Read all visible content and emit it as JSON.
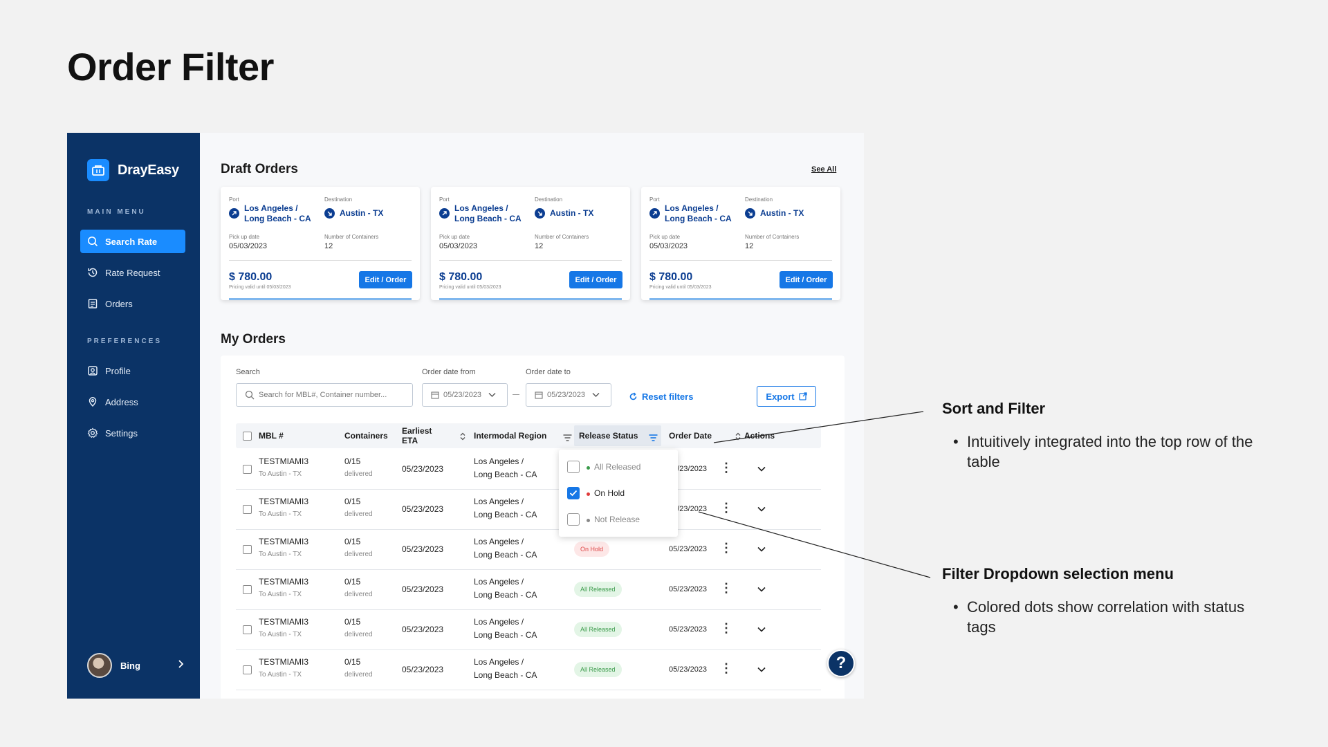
{
  "slide": {
    "title": "Order Filter"
  },
  "brand": {
    "name": "DrayEasy",
    "accent": "#1a8cff",
    "navy": "#0b3366"
  },
  "sidebar": {
    "main_menu_heading": "MAIN MENU",
    "preferences_heading": "PREFERENCES",
    "items": [
      {
        "label": "Search Rate",
        "icon": "search-icon",
        "active": true
      },
      {
        "label": "Rate Request",
        "icon": "history-icon"
      },
      {
        "label": "Orders",
        "icon": "document-icon"
      },
      {
        "label": "Profile",
        "icon": "profile-icon"
      },
      {
        "label": "Address",
        "icon": "location-pin-icon"
      },
      {
        "label": "Settings",
        "icon": "gear-icon"
      }
    ],
    "user": {
      "name": "Bing"
    }
  },
  "draft_orders": {
    "title": "Draft Orders",
    "see_all": "See All",
    "cards": [
      {
        "port_label": "Port",
        "port_line1": "Los Angeles /",
        "port_line2": "Long Beach - CA",
        "dest_label": "Destination",
        "dest": "Austin - TX",
        "pickup_label": "Pick up date",
        "pickup": "05/03/2023",
        "containers_label": "Number of Containers",
        "containers": "12",
        "price": "$ 780.00",
        "price_note": "Pricing valid until 05/03/2023",
        "button": "Edit / Order"
      },
      {
        "port_label": "Port",
        "port_line1": "Los Angeles /",
        "port_line2": "Long Beach - CA",
        "dest_label": "Destination",
        "dest": "Austin - TX",
        "pickup_label": "Pick up date",
        "pickup": "05/03/2023",
        "containers_label": "Number of Containers",
        "containers": "12",
        "price": "$ 780.00",
        "price_note": "Pricing valid until 05/03/2023",
        "button": "Edit / Order"
      },
      {
        "port_label": "Port",
        "port_line1": "Los Angeles /",
        "port_line2": "Long Beach - CA",
        "dest_label": "Destination",
        "dest": "Austin - TX",
        "pickup_label": "Pick up date",
        "pickup": "05/03/2023",
        "containers_label": "Number of Containers",
        "containers": "12",
        "price": "$ 780.00",
        "price_note": "Pricing valid until 05/03/2023",
        "button": "Edit / Order"
      }
    ]
  },
  "my_orders": {
    "title": "My Orders",
    "search_label": "Search",
    "search_placeholder": "Search for MBL#, Container number...",
    "date_from_label": "Order date from",
    "date_from": "05/23/2023",
    "date_to_label": "Order date to",
    "date_to": "05/23/2023",
    "reset_label": "Reset filters",
    "export_label": "Export",
    "columns": {
      "mbl": "MBL #",
      "containers": "Containers",
      "eta": "Earliest ETA",
      "region": "Intermodal Region",
      "release": "Release Status",
      "order_date": "Order Date",
      "actions": "Actions"
    },
    "rows": [
      {
        "mbl": "TESTMIAMI3",
        "to": "To Austin - TX",
        "containers": "0/15",
        "delivered": "delivered",
        "eta": "05/23/2023",
        "region1": "Los Angeles /",
        "region2": "Long Beach - CA",
        "status": "",
        "order_date": "05/23/2023"
      },
      {
        "mbl": "TESTMIAMI3",
        "to": "To Austin - TX",
        "containers": "0/15",
        "delivered": "delivered",
        "eta": "05/23/2023",
        "region1": "Los Angeles /",
        "region2": "Long Beach - CA",
        "status": "",
        "order_date": "05/23/2023"
      },
      {
        "mbl": "TESTMIAMI3",
        "to": "To Austin - TX",
        "containers": "0/15",
        "delivered": "delivered",
        "eta": "05/23/2023",
        "region1": "Los Angeles /",
        "region2": "Long Beach - CA",
        "status": "On Hold",
        "order_date": "05/23/2023"
      },
      {
        "mbl": "TESTMIAMI3",
        "to": "To Austin - TX",
        "containers": "0/15",
        "delivered": "delivered",
        "eta": "05/23/2023",
        "region1": "Los Angeles /",
        "region2": "Long Beach - CA",
        "status": "All Released",
        "order_date": "05/23/2023"
      },
      {
        "mbl": "TESTMIAMI3",
        "to": "To Austin - TX",
        "containers": "0/15",
        "delivered": "delivered",
        "eta": "05/23/2023",
        "region1": "Los Angeles /",
        "region2": "Long Beach - CA",
        "status": "All Released",
        "order_date": "05/23/2023"
      },
      {
        "mbl": "TESTMIAMI3",
        "to": "To Austin - TX",
        "containers": "0/15",
        "delivered": "delivered",
        "eta": "05/23/2023",
        "region1": "Los Angeles /",
        "region2": "Long Beach - CA",
        "status": "All Released",
        "order_date": "05/23/2023"
      }
    ],
    "filter_dropdown": {
      "options": [
        {
          "label": "All Released",
          "checked": false,
          "dot_color": "#3a9a4a"
        },
        {
          "label": "On Hold",
          "checked": true,
          "dot_color": "#e03a3a"
        },
        {
          "label": "Not Release",
          "checked": false,
          "dot_color": "#888888"
        }
      ]
    }
  },
  "help_button": "?",
  "annotations": [
    {
      "title": "Sort and Filter",
      "bullet": "Intuitively integrated into the top row of the table"
    },
    {
      "title": "Filter Dropdown selection menu",
      "bullet": "Colored dots show correlation with status tags"
    }
  ]
}
